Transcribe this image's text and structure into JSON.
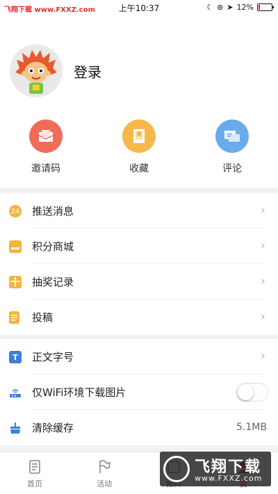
{
  "status_bar": {
    "carrier_watermark": "飞翔下载 www.FXXZ.com",
    "time": "上午10:37",
    "battery": "12%",
    "battery_level": 0.12
  },
  "profile": {
    "login_label": "登录"
  },
  "shortcuts": [
    {
      "label": "邀请码",
      "color": "#f06c5a",
      "icon": "envelope-icon"
    },
    {
      "label": "收藏",
      "color": "#f7b84b",
      "icon": "bookmark-icon"
    },
    {
      "label": "评论",
      "color": "#6aabea",
      "icon": "comment-icon"
    }
  ],
  "menu_group1": [
    {
      "label": "推送消息",
      "icon": "push-icon",
      "color": "#f5b43c"
    },
    {
      "label": "积分商城",
      "icon": "points-mall-icon",
      "color": "#f5b43c"
    },
    {
      "label": "抽奖记录",
      "icon": "gift-icon",
      "color": "#f5b43c"
    },
    {
      "label": "投稿",
      "icon": "contribute-icon",
      "color": "#f5b43c"
    }
  ],
  "menu_group2": [
    {
      "label": "正文字号",
      "icon": "font-size-icon",
      "color": "#3b7fd9"
    },
    {
      "label": "仅WiFi环境下载图片",
      "icon": "wifi-router-icon",
      "color": "#3b7fd9",
      "toggle_on": false
    },
    {
      "label": "清除缓存",
      "icon": "clear-cache-icon",
      "color": "#3b7fd9",
      "value": "5.1MB"
    }
  ],
  "tabs": [
    {
      "label": "首页",
      "icon": "home-icon",
      "active": false
    },
    {
      "label": "活动",
      "icon": "flag-icon",
      "active": false
    },
    {
      "label": "报料",
      "icon": "report-icon",
      "active": false
    },
    {
      "label": "我",
      "icon": "me-icon",
      "active": true
    }
  ],
  "watermark": {
    "text": "飞翔下载",
    "url": "www.FXXZ.com"
  }
}
